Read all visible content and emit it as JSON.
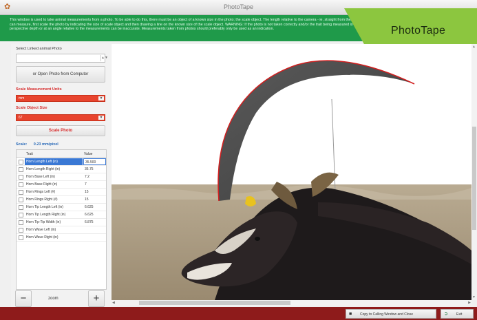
{
  "window": {
    "title": "PhotoTape",
    "icon": "app-icon"
  },
  "banner": {
    "text": "This window is used to take animal measurements from a photo. To be able to do this, there must be an object of a known size in the photo; the scale object. The length relative to the camera - ie, straight from the front. Before you can measure, first scale the photo by indicating the size of scale object and then drawing a line on the known size of the scale object. WARNING: If the photo is not taken correctly and/or the trait being measured is not at the same perspective depth or at an angle relative to the measurements can be inaccurate. Measurements taken from photos should preferably only be used as an indication."
  },
  "brand": {
    "label": "PhotoTape",
    "color": "#8cc63f"
  },
  "left_panel": {
    "url_label": "Select Linked animal Photo",
    "url_value": "",
    "open_button": "or Open Photo from Computer",
    "unit_label": "Scale Measurement Units",
    "unit_value": "mm",
    "size_label": "Scale Object Size",
    "size_value": "67",
    "scale_button": "Scale Photo",
    "scale_label": "Scale:",
    "scale_value": "0.23 mm/pixel",
    "grid": {
      "headers": [
        "Trait",
        "Value"
      ],
      "rows": [
        {
          "name": "Horn Length Left (in)",
          "value": "35.500",
          "selected": true
        },
        {
          "name": "Horn Length Right (in)",
          "value": "36.75"
        },
        {
          "name": "Horn Base Left (in)",
          "value": "7.2"
        },
        {
          "name": "Horn Base Right (in)",
          "value": "7"
        },
        {
          "name": "Horn Rings Left (#)",
          "value": "15"
        },
        {
          "name": "Horn Rings Right (#)",
          "value": "15"
        },
        {
          "name": "Horn Tip Length Left (in)",
          "value": "6.625"
        },
        {
          "name": "Horn Tip Length Right (in)",
          "value": "6.625"
        },
        {
          "name": "Horn Tip-Tip Width (in)",
          "value": "6.875"
        },
        {
          "name": "Horn Wave Left (in)",
          "value": ""
        },
        {
          "name": "Horn Wave Right (in)",
          "value": ""
        }
      ]
    },
    "zoom_minus": "−",
    "zoom_label": "zoom",
    "zoom_plus": "+"
  },
  "bottom_bar": {
    "copy_button": "Copy to Calling Window and Close",
    "exit_button": "Exit"
  }
}
